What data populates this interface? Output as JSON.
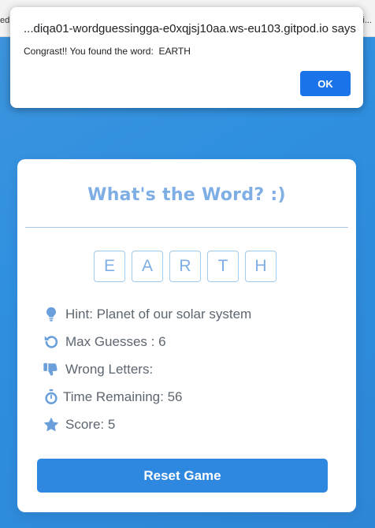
{
  "browser": {
    "tab_left_fragment": "ed",
    "tab_right_fragment": "Bui..."
  },
  "alert": {
    "origin": "...diqa01-wordguessingga-e0xqjsj10aa.ws-eu103.gitpod.io says",
    "message": "Congrast!! You found the word:  EARTH",
    "ok_label": "OK"
  },
  "game": {
    "title": "What's the Word? :)",
    "letters": [
      "E",
      "A",
      "R",
      "T",
      "H"
    ],
    "hint": "Hint: Planet of our solar system",
    "max_guesses": "Max Guesses : 6",
    "wrong_letters": "Wrong Letters:",
    "time_remaining": "Time Remaining: 56",
    "score": "Score: 5",
    "reset_label": "Reset Game"
  },
  "colors": {
    "accent": "#2f88e0",
    "icon": "#6a9fdc",
    "title": "#7eaee4",
    "dialog_button": "#1a73e8"
  },
  "icons": [
    "lightbulb-icon",
    "undo-icon",
    "thumbs-down-icon",
    "stopwatch-icon",
    "star-icon"
  ]
}
